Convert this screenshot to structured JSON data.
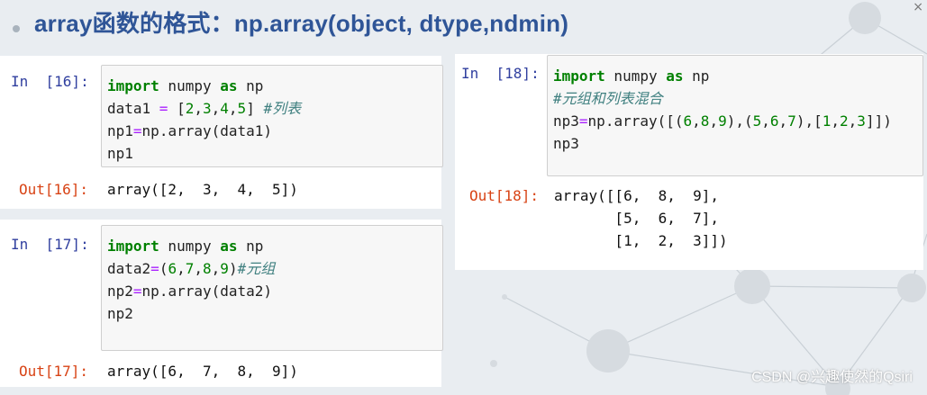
{
  "title": "array函数的格式：np.array(object, dtype,ndmin)",
  "close_glyph": "×",
  "watermark": "CSDN @兴趣使然的Qsiri",
  "cells": {
    "c16": {
      "in_prompt": "In  [16]:",
      "out_prompt": "Out[16]:",
      "lines": [
        [
          {
            "t": "import",
            "c": "kw"
          },
          {
            "t": " numpy "
          },
          {
            "t": "as",
            "c": "kw"
          },
          {
            "t": " np"
          }
        ],
        [
          {
            "t": "data1 "
          },
          {
            "t": "=",
            "c": "op"
          },
          {
            "t": " ["
          },
          {
            "t": "2",
            "c": "num"
          },
          {
            "t": ","
          },
          {
            "t": "3",
            "c": "num"
          },
          {
            "t": ","
          },
          {
            "t": "4",
            "c": "num"
          },
          {
            "t": ","
          },
          {
            "t": "5",
            "c": "num"
          },
          {
            "t": "] "
          },
          {
            "t": "#列表",
            "c": "cm"
          }
        ],
        [
          {
            "t": "np1"
          },
          {
            "t": "=",
            "c": "op"
          },
          {
            "t": "np.array(data1)"
          }
        ],
        [
          {
            "t": "np1"
          }
        ]
      ],
      "output": [
        "array([2,  3,  4,  5])"
      ]
    },
    "c17": {
      "in_prompt": "In  [17]:",
      "out_prompt": "Out[17]:",
      "lines": [
        [
          {
            "t": "import",
            "c": "kw"
          },
          {
            "t": " numpy "
          },
          {
            "t": "as",
            "c": "kw"
          },
          {
            "t": " np"
          }
        ],
        [
          {
            "t": "data2"
          },
          {
            "t": "=",
            "c": "op"
          },
          {
            "t": "("
          },
          {
            "t": "6",
            "c": "num"
          },
          {
            "t": ","
          },
          {
            "t": "7",
            "c": "num"
          },
          {
            "t": ","
          },
          {
            "t": "8",
            "c": "num"
          },
          {
            "t": ","
          },
          {
            "t": "9",
            "c": "num"
          },
          {
            "t": ")"
          },
          {
            "t": "#元组",
            "c": "cm"
          }
        ],
        [
          {
            "t": "np2"
          },
          {
            "t": "=",
            "c": "op"
          },
          {
            "t": "np.array(data2)"
          }
        ],
        [
          {
            "t": "np2"
          }
        ]
      ],
      "output": [
        "array([6,  7,  8,  9])"
      ]
    },
    "c18": {
      "in_prompt": "In  [18]:",
      "out_prompt": "Out[18]:",
      "lines": [
        [
          {
            "t": "import",
            "c": "kw"
          },
          {
            "t": " numpy "
          },
          {
            "t": "as",
            "c": "kw"
          },
          {
            "t": " np"
          }
        ],
        [
          {
            "t": "#元组和列表混合",
            "c": "cm"
          }
        ],
        [
          {
            "t": "np3"
          },
          {
            "t": "=",
            "c": "op"
          },
          {
            "t": "np.array([("
          },
          {
            "t": "6",
            "c": "num"
          },
          {
            "t": ","
          },
          {
            "t": "8",
            "c": "num"
          },
          {
            "t": ","
          },
          {
            "t": "9",
            "c": "num"
          },
          {
            "t": "),("
          },
          {
            "t": "5",
            "c": "num"
          },
          {
            "t": ","
          },
          {
            "t": "6",
            "c": "num"
          },
          {
            "t": ","
          },
          {
            "t": "7",
            "c": "num"
          },
          {
            "t": "),["
          },
          {
            "t": "1",
            "c": "num"
          },
          {
            "t": ","
          },
          {
            "t": "2",
            "c": "num"
          },
          {
            "t": ","
          },
          {
            "t": "3",
            "c": "num"
          },
          {
            "t": "]])"
          }
        ],
        [
          {
            "t": "np3"
          }
        ]
      ],
      "output": [
        "array([[6,  8,  9],",
        "       [5,  6,  7],",
        "       [1,  2,  3]])"
      ]
    }
  }
}
